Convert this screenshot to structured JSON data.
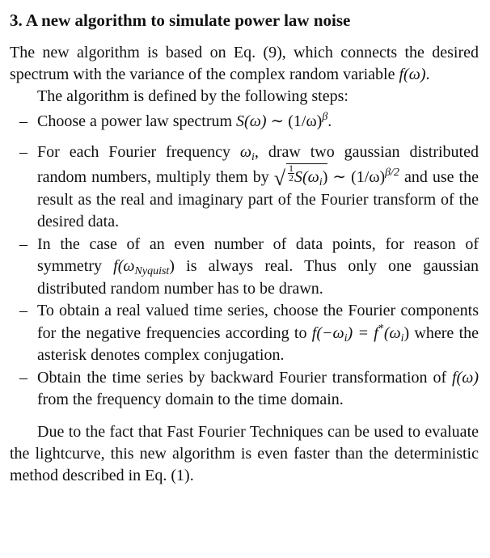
{
  "section": {
    "heading": "3. A new algorithm to simulate power law noise"
  },
  "intro": {
    "text": "The new algorithm is based on Eq. (9), which connects the desired spectrum with the variance of the complex random variable ",
    "f_omega": "f(ω)",
    "end": "."
  },
  "steps_intro": "The algorithm is defined by the following steps:",
  "steps": {
    "s1": {
      "dash": "–",
      "t1": "Choose a power law spectrum ",
      "S": "S(ω)",
      "sim": " ∼ (1/ω)",
      "beta": "β",
      "end": "."
    },
    "s2": {
      "dash": "–",
      "t1": "For each Fourier frequency ",
      "omega": "ω",
      "i": "i",
      "t2": ", draw two gaussian distributed random numbers, multiply them by ",
      "half_num": "1",
      "half_den": "2",
      "S": "S(ω",
      "close": ")",
      "sim": " ∼ (1/ω)",
      "exp": "β/2",
      "t3": " and use the result as the real and imaginary part of the Fourier transform of the desired data."
    },
    "s3": {
      "dash": "–",
      "t1": "In the case of an even number of data points, for reason of symmetry ",
      "f": "f(ω",
      "nyq": "Nyquist",
      "t2": ") is always real. Thus only one gaussian distributed random number has to be drawn."
    },
    "s4": {
      "dash": "–",
      "t1": "To obtain a real valued time series, choose the Fourier components for the negative frequencies according to ",
      "eq1": "f(−ω",
      "eq2": ") = f",
      "star": "*",
      "eq3": "(ω",
      "t2": ") where the asterisk denotes complex conjugation."
    },
    "s5": {
      "dash": "–",
      "t1": "Obtain the time series by backward Fourier transformation of ",
      "f": "f(ω)",
      "t2": " from the frequency domain to the time domain."
    }
  },
  "closing": "Due to the fact that Fast Fourier Techniques can be used to evaluate the lightcurve, this new algorithm is even faster than the deterministic method described in Eq. (1).",
  "symbols": {
    "i": "i",
    "sqrt": "√"
  }
}
